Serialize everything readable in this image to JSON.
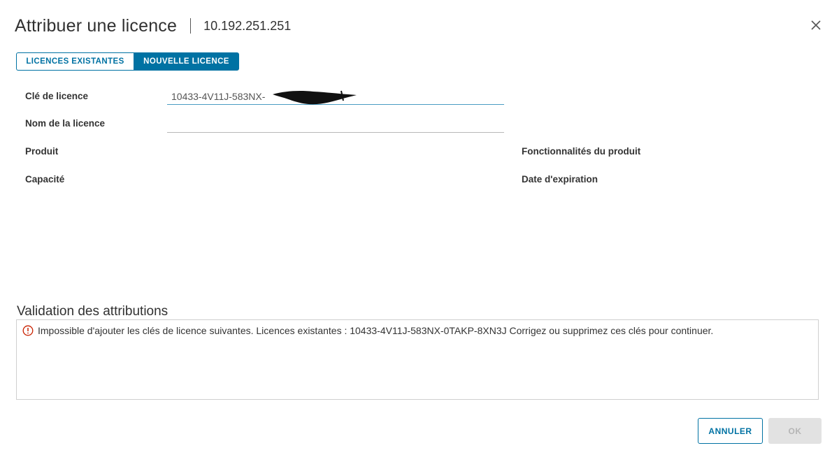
{
  "header": {
    "title": "Attribuer une licence",
    "host": "10.192.251.251",
    "close_icon": "close-icon"
  },
  "tabs": [
    {
      "label": "LICENCES EXISTANTES",
      "selected": false
    },
    {
      "label": "NOUVELLE LICENCE",
      "selected": true
    }
  ],
  "form": {
    "license_key": {
      "label": "Clé de licence",
      "value": "10433-4V11J-583NX-"
    },
    "license_name": {
      "label": "Nom de la licence",
      "value": ""
    },
    "product": {
      "label": "Produit"
    },
    "capacity": {
      "label": "Capacité"
    },
    "features": {
      "label": "Fonctionnalités du produit"
    },
    "expiration": {
      "label": "Date d'expiration"
    }
  },
  "validation": {
    "title": "Validation des attributions",
    "message": "Impossible d'ajouter les clés de licence suivantes. Licences existantes : 10433-4V11J-583NX-0TAKP-8XN3J Corrigez ou supprimez ces clés pour continuer.",
    "icon": "error-circle-icon"
  },
  "footer": {
    "cancel_label": "ANNULER",
    "ok_label": "OK"
  },
  "colors": {
    "accent": "#0072a3",
    "error": "#c92100",
    "disabled_bg": "#e2e2e2"
  }
}
